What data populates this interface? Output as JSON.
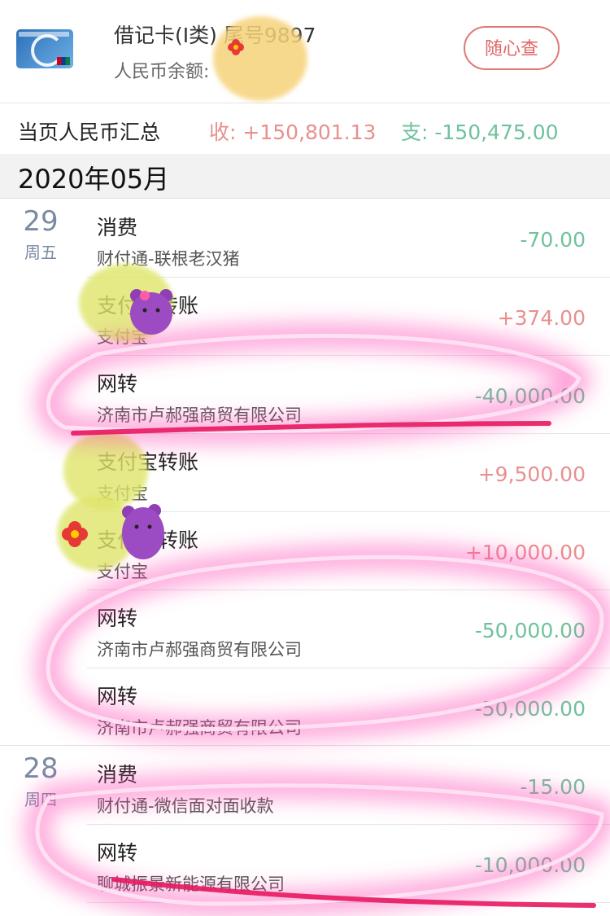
{
  "header": {
    "card_title": "借记卡(Ⅰ类) 尾号9897",
    "balance_label": "人民币余额:",
    "button": "随心查"
  },
  "summary": {
    "label": "当页人民币汇总",
    "income": "收: +150,801.13",
    "expense": "支: -150,475.00"
  },
  "month": "2020年05月",
  "groups": [
    {
      "day": "29",
      "weekday": "周五"
    },
    {
      "day": "28",
      "weekday": "周四"
    }
  ],
  "transactions": [
    {
      "title": "消费",
      "sub": "财付通-联根老汉猪",
      "amount": "-70.00"
    },
    {
      "title": "支付宝转账",
      "sub": "支付宝",
      "amount": "+374.00"
    },
    {
      "title": "网转",
      "sub": "济南市卢郝强商贸有限公司",
      "amount": "-40,000.00"
    },
    {
      "title": "支付宝转账",
      "sub": "支付宝",
      "amount": "+9,500.00"
    },
    {
      "title": "支付宝转账",
      "sub": "支付宝",
      "amount": "+10,000.00"
    },
    {
      "title": "网转",
      "sub": "济南市卢郝强商贸有限公司",
      "amount": "-50,000.00"
    },
    {
      "title": "网转",
      "sub": "济南市卢郝强商贸有限公司",
      "amount": "-50,000.00"
    },
    {
      "title": "消费",
      "sub": "财付通-微信面对面收款",
      "amount": "-15.00"
    },
    {
      "title": "网转",
      "sub": "聊城振景新能源有限公司",
      "amount": "-10,000.00"
    }
  ],
  "colors": {
    "income": "#e88f8f",
    "expense": "#6fc29b",
    "button": "#e06666",
    "highlight": "#ff3fb0"
  }
}
